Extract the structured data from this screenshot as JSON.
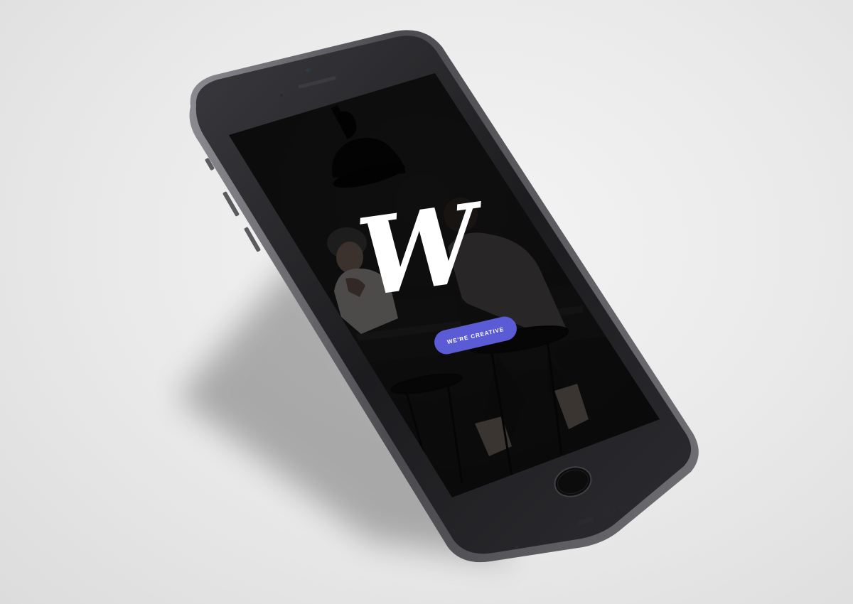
{
  "app": {
    "logo_letter": "W",
    "cta_label": "WE'RE CREATIVE"
  },
  "colors": {
    "background": "#ececec",
    "phone_body": "#1b1b1d",
    "screen": "#0b0b0c",
    "cta": "#5b5bd6",
    "logo": "#ffffff"
  },
  "icons": {
    "home_button": "home-button-icon",
    "camera": "front-camera-icon",
    "speaker": "earpiece-icon"
  }
}
